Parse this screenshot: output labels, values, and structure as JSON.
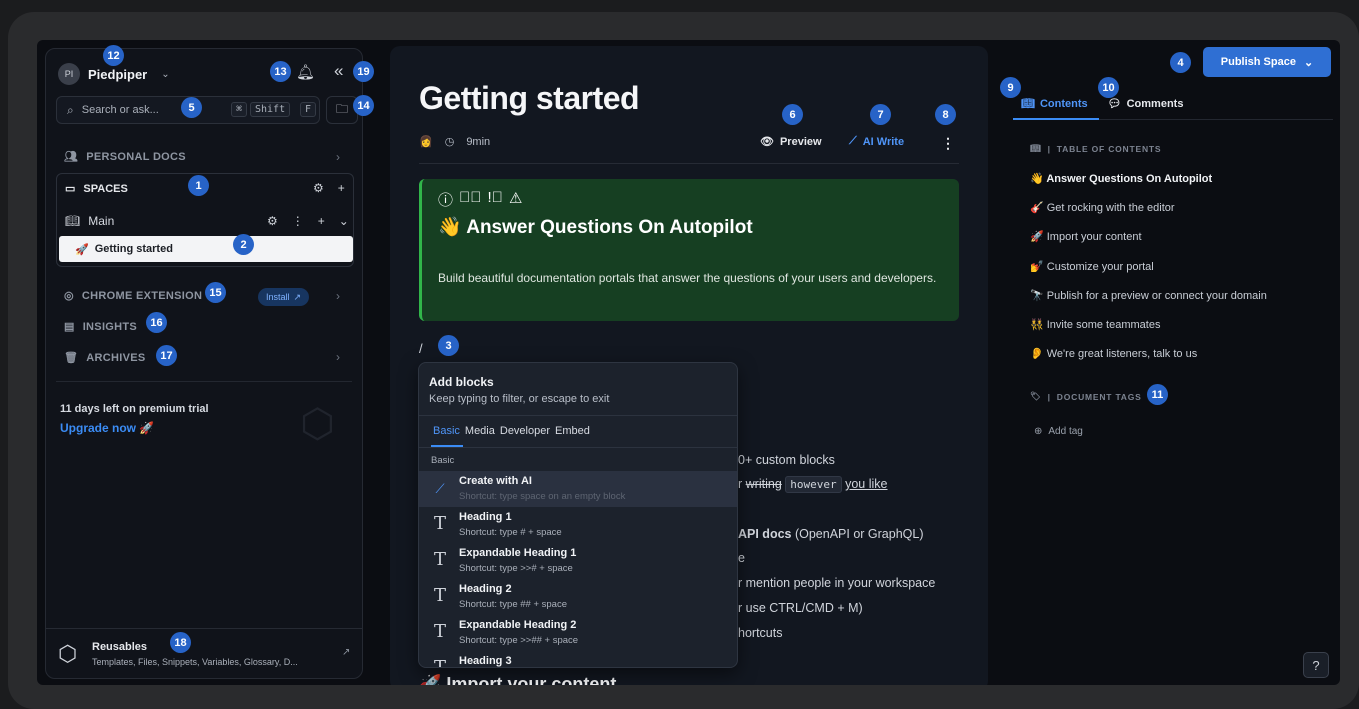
{
  "sidebar": {
    "avatar": "PI",
    "org": "Piedpiper",
    "search_placeholder": "Search or ask...",
    "kbd": [
      "⌘",
      "Shift",
      "F"
    ],
    "personal_docs": "PERSONAL DOCS",
    "spaces": "SPACES",
    "main": "Main",
    "active_doc": "Getting started",
    "chrome_extension": "CHROME EXTENSION",
    "install": "Install",
    "insights": "INSIGHTS",
    "archives": "ARCHIVES",
    "trial": "11 days left on premium trial",
    "upgrade": "Upgrade now 🚀",
    "reusables_title": "Reusables",
    "reusables_sub": "Templates, Files, Snippets, Variables, Glossary, D..."
  },
  "editor": {
    "title": "Getting started",
    "read_time": "9min",
    "preview": "Preview",
    "ai_write": "AI Write",
    "callout_title": "👋 Answer Questions On Autopilot",
    "callout_body": "Build beautiful documentation portals that answer the questions of your users and developers.",
    "slash": "/",
    "bg": {
      "l1": "0+ custom blocks",
      "l2a": "r",
      "l2b": "writing",
      "l2c": "however",
      "l2d": "you like",
      "l3a": "API docs",
      "l3b": " (OpenAPI or GraphQL)",
      "l4": "e",
      "l5": "r mention people in your workspace",
      "l6": "r use CTRL/CMD + M)",
      "l7": "hortcuts"
    },
    "next_heading": "🚀 Import your content"
  },
  "popup": {
    "title": "Add blocks",
    "subtitle": "Keep typing to filter, or escape to exit",
    "tabs": [
      "Basic",
      "Media",
      "Developer",
      "Embed"
    ],
    "group": "Basic",
    "items": [
      {
        "label": "Create with AI",
        "hint": "Shortcut: type space on an empty block",
        "icon": "ai-icon"
      },
      {
        "label": "Heading 1",
        "hint": "Shortcut: type # + space",
        "icon": "T"
      },
      {
        "label": "Expandable Heading 1",
        "hint": "Shortcut: type >># + space",
        "icon": "T"
      },
      {
        "label": "Heading 2",
        "hint": "Shortcut: type ## + space",
        "icon": "T"
      },
      {
        "label": "Expandable Heading 2",
        "hint": "Shortcut: type >>## + space",
        "icon": "T"
      },
      {
        "label": "Heading 3",
        "hint": "",
        "icon": "T"
      }
    ]
  },
  "right": {
    "publish": "Publish Space",
    "tab_contents": "Contents",
    "tab_comments": "Comments",
    "toc_head": "TABLE OF CONTENTS",
    "toc": [
      "👋 Answer Questions On Autopilot",
      "🎸 Get rocking with the editor",
      "🚀 Import your content",
      "💅 Customize your portal",
      "🔭 Publish for a preview or connect your domain",
      "👯 Invite some teammates",
      "👂 We're great listeners, talk to us"
    ],
    "tags_head": "DOCUMENT TAGS",
    "add_tag": "Add tag"
  },
  "badges": [
    "1",
    "2",
    "3",
    "4",
    "5",
    "6",
    "7",
    "8",
    "9",
    "10",
    "11",
    "12",
    "13",
    "14",
    "15",
    "16",
    "17",
    "18",
    "19"
  ],
  "colors": {
    "accent": "#2f6fd3",
    "badge": "#2763c7",
    "callout_bg": "#163f22",
    "callout_border": "#31b64a",
    "highlight_link": "#3b8cf5"
  }
}
